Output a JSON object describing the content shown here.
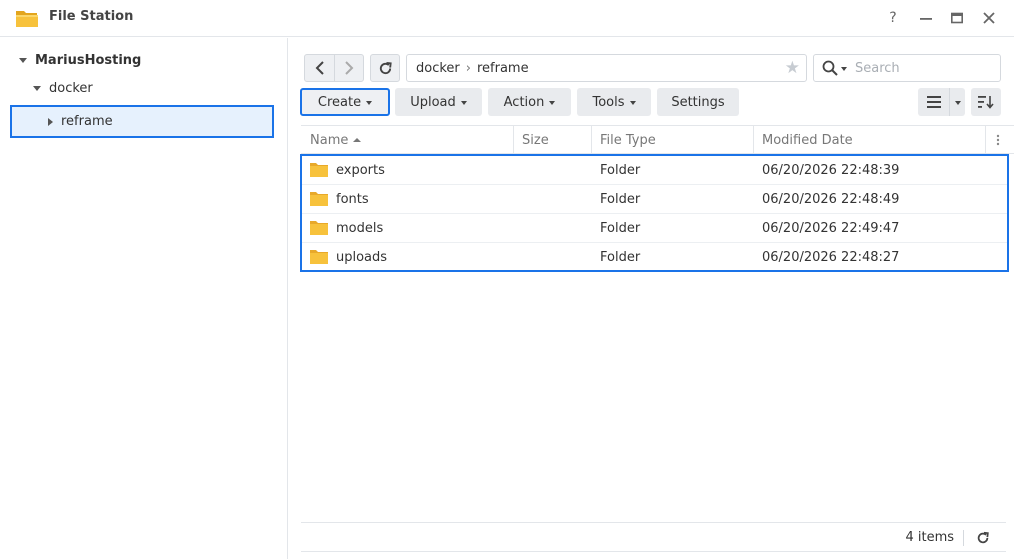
{
  "window": {
    "title": "File Station",
    "help_label": "?",
    "accent": "#1a73e8",
    "folder_color": "#f7c23c"
  },
  "sidebar": {
    "root": "MariusHosting",
    "children": [
      {
        "label": "docker",
        "expanded": true
      },
      {
        "label": "reframe",
        "expanded": false,
        "selected": true
      }
    ]
  },
  "toolbar": {
    "path": [
      "docker",
      "reframe"
    ],
    "search_placeholder": "Search",
    "buttons": {
      "create": "Create",
      "upload": "Upload",
      "action": "Action",
      "tools": "Tools",
      "settings": "Settings"
    }
  },
  "table": {
    "columns": {
      "name": "Name",
      "size": "Size",
      "type": "File Type",
      "modified": "Modified Date"
    },
    "rows": [
      {
        "name": "exports",
        "size": "",
        "type": "Folder",
        "modified": "06/20/2026 22:48:39"
      },
      {
        "name": "fonts",
        "size": "",
        "type": "Folder",
        "modified": "06/20/2026 22:48:49"
      },
      {
        "name": "models",
        "size": "",
        "type": "Folder",
        "modified": "06/20/2026 22:49:47"
      },
      {
        "name": "uploads",
        "size": "",
        "type": "Folder",
        "modified": "06/20/2026 22:48:27"
      }
    ]
  },
  "footer": {
    "count": "4 items"
  }
}
